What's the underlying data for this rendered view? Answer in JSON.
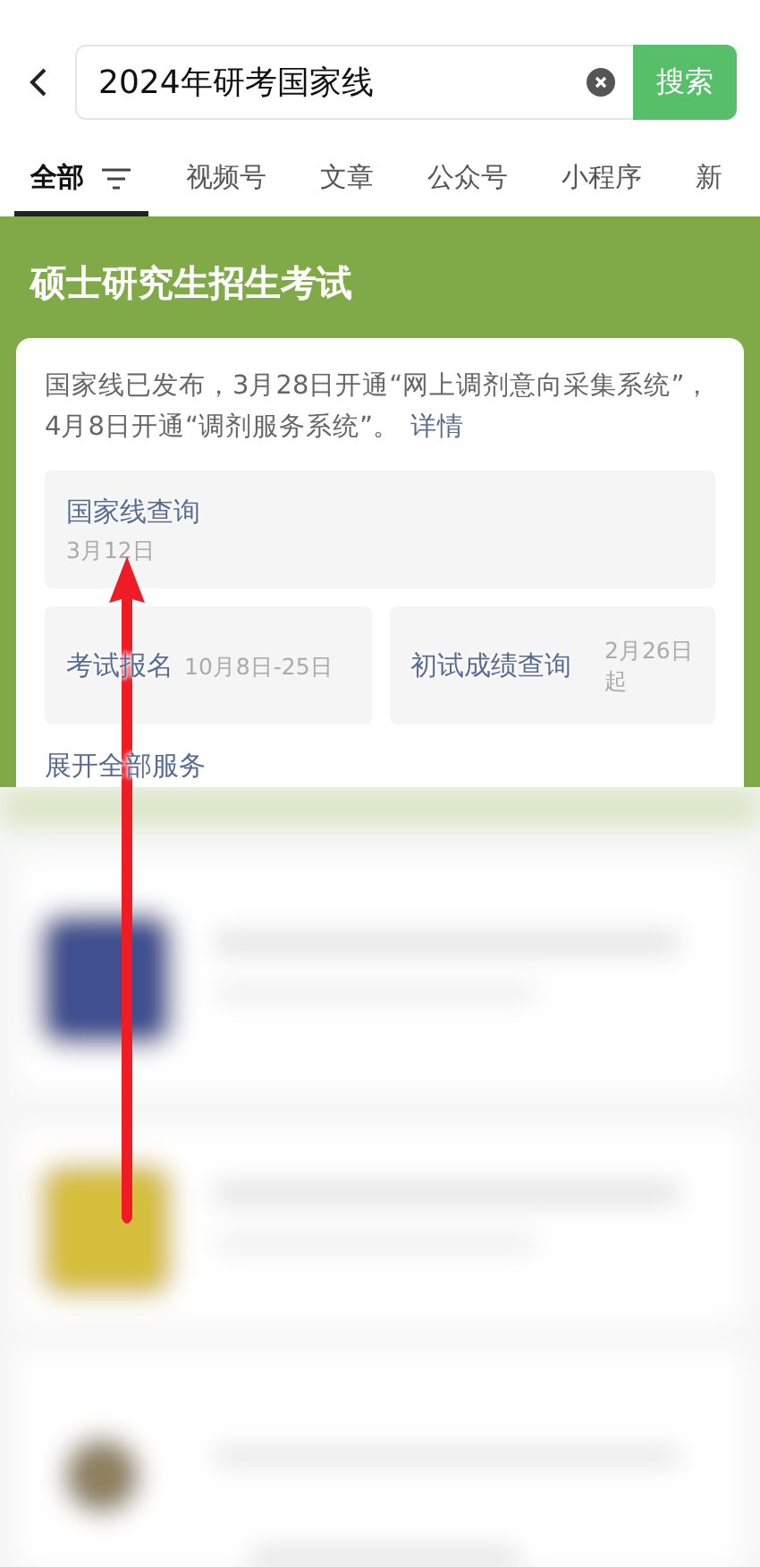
{
  "search": {
    "value": "2024年研考国家线",
    "button": "搜索"
  },
  "tabs": [
    {
      "label": "全部",
      "selected": true,
      "filter": true
    },
    {
      "label": "视频号",
      "selected": false
    },
    {
      "label": "文章",
      "selected": false
    },
    {
      "label": "公众号",
      "selected": false
    },
    {
      "label": "小程序",
      "selected": false
    },
    {
      "label": "新",
      "selected": false
    }
  ],
  "banner": {
    "title": "硕士研究生招生考试",
    "notice": "国家线已发布，3月28日开通“网上调剂意向采集系统”，4月8日开通“调剂服务系统”。",
    "notice_link": "详情",
    "services": [
      {
        "kind": "wide",
        "name": "国家线查询",
        "date": "3月12日"
      },
      {
        "kind": "half",
        "name": "考试报名",
        "date": "10月8日-25日"
      },
      {
        "kind": "half",
        "name": "初试成绩查询",
        "date": "2月26日起"
      }
    ],
    "expand": "展开全部服务"
  }
}
